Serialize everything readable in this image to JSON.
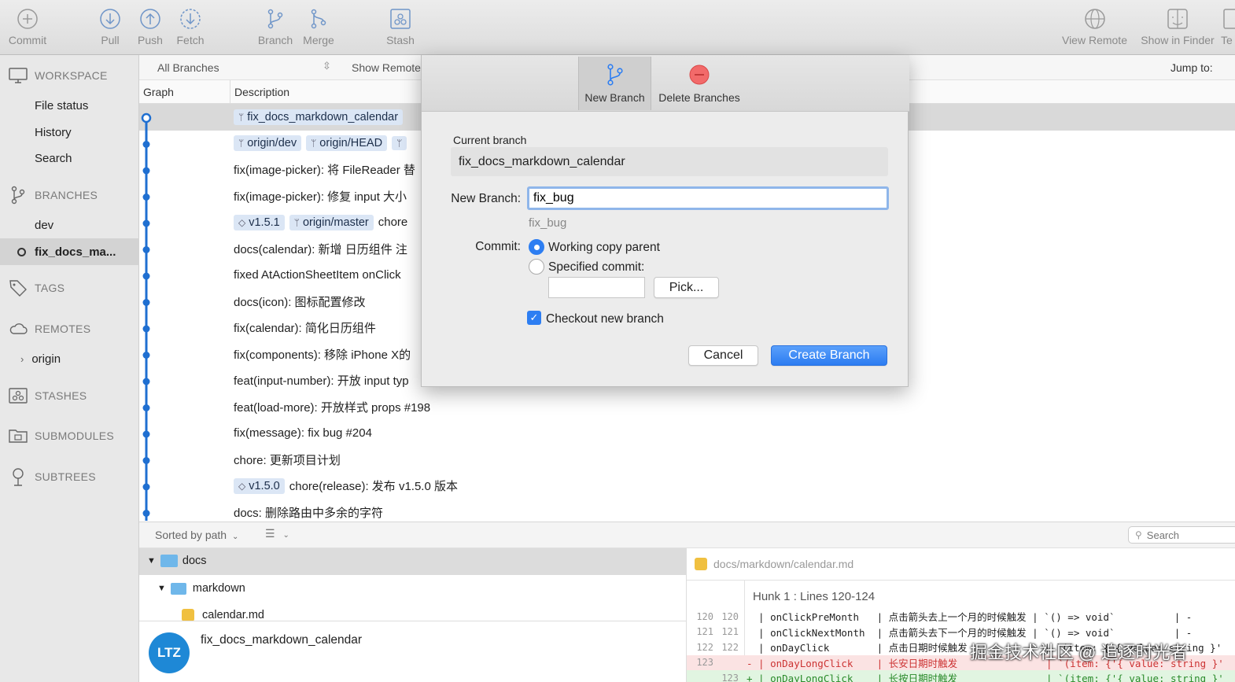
{
  "toolbar": {
    "commit": "Commit",
    "pull": "Pull",
    "push": "Push",
    "fetch": "Fetch",
    "branch": "Branch",
    "merge": "Merge",
    "stash": "Stash",
    "view_remote": "View Remote",
    "show_in_finder": "Show in Finder",
    "terminal_partial": "Te"
  },
  "sidebar": {
    "workspace": "WORKSPACE",
    "file_status": "File status",
    "history": "History",
    "search": "Search",
    "branches": "BRANCHES",
    "branch_dev": "dev",
    "branch_current": "fix_docs_ma...",
    "tags": "TAGS",
    "remotes": "REMOTES",
    "remote_origin": "origin",
    "stashes": "STASHES",
    "submodules": "SUBMODULES",
    "subtrees": "SUBTREES"
  },
  "listbar": {
    "branch_filter": "All Branches",
    "show_remote": "Show Remote",
    "jump_to": "Jump to:"
  },
  "columns": {
    "graph": "Graph",
    "description": "Description"
  },
  "commits": [
    {
      "tags": [
        "fix_docs_markdown_calendar"
      ],
      "text": ""
    },
    {
      "tags": [
        "origin/dev",
        "origin/HEAD",
        ""
      ],
      "text": ""
    },
    {
      "tags": [],
      "text": "fix(image-picker): 将 FileReader 替"
    },
    {
      "tags": [],
      "text": "fix(image-picker): 修复 input 大小"
    },
    {
      "tags": [
        "v1.5.1",
        "origin/master"
      ],
      "text": "chore"
    },
    {
      "tags": [],
      "text": "docs(calendar): 新增 日历组件 注"
    },
    {
      "tags": [],
      "text": "fixed AtActionSheetItem onClick"
    },
    {
      "tags": [],
      "text": "docs(icon): 图标配置修改"
    },
    {
      "tags": [],
      "text": "fix(calendar): 简化日历组件"
    },
    {
      "tags": [],
      "text": "fix(components): 移除 iPhone X的"
    },
    {
      "tags": [],
      "text": "feat(input-number): 开放 input typ"
    },
    {
      "tags": [],
      "text": "feat(load-more): 开放样式 props #198"
    },
    {
      "tags": [],
      "text": "fix(message): fix bug #204"
    },
    {
      "tags": [],
      "text": "chore: 更新项目计划"
    },
    {
      "tags": [
        "v1.5.0"
      ],
      "text": "chore(release): 发布 v1.5.0 版本"
    },
    {
      "tags": [],
      "text": "docs: 删除路由中多余的字符"
    }
  ],
  "filebar": {
    "sort": "Sorted by path",
    "search_placeholder": "Search"
  },
  "filetree": {
    "folder1": "docs",
    "folder2": "markdown",
    "file": "calendar.md"
  },
  "author": {
    "initials": "LTZ",
    "branch": "fix_docs_markdown_calendar"
  },
  "diff": {
    "path": "docs/markdown/calendar.md",
    "hunk": "Hunk 1 : Lines 120-124",
    "lines": [
      {
        "old": "120",
        "new": "120",
        "type": "ctx",
        "text": "  | onClickPreMonth   | 点击箭头去上一个月的时候触发 | `() => void`          | -"
      },
      {
        "old": "121",
        "new": "121",
        "type": "ctx",
        "text": "  | onClickNextMonth  | 点击箭头去下一个月的时候触发 | `() => void`          | -"
      },
      {
        "old": "122",
        "new": "122",
        "type": "ctx",
        "text": "  | onDayClick        | 点击日期时候触发             | `(item: {'{ value: string }'"
      },
      {
        "old": "123",
        "new": "",
        "type": "minus",
        "text": "- | onDayLongClick    | 长安日期时触发               | `(item: {'{ value: string }'"
      },
      {
        "old": "",
        "new": "123",
        "type": "plus",
        "text": "+ | onDayLongClick    | 长按日期时触发               | `(item: {'{ value: string }'"
      }
    ]
  },
  "modal": {
    "tab_new": "New Branch",
    "tab_delete": "Delete Branches",
    "current_branch_label": "Current branch",
    "current_branch_value": "fix_docs_markdown_calendar",
    "new_branch_label": "New Branch:",
    "new_branch_value": "fix_bug",
    "new_branch_hint": "fix_bug",
    "commit_label": "Commit:",
    "radio_working": "Working copy parent",
    "radio_specified": "Specified commit:",
    "pick": "Pick...",
    "checkout": "Checkout new branch",
    "cancel": "Cancel",
    "create": "Create Branch"
  },
  "watermark": "掘金技术社区 @ 追逐时光者",
  "colors": {
    "accent": "#2d7ef2",
    "graph_line": "#1f6fd1"
  }
}
